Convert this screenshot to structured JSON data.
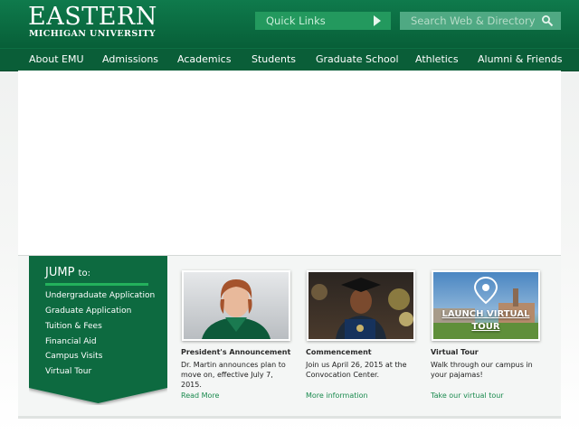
{
  "header": {
    "logo_main": "EASTERN",
    "logo_sub": "MICHIGAN UNIVERSITY",
    "quick_links_label": "Quick Links",
    "search_placeholder": "Search Web & Directory"
  },
  "nav": {
    "items": [
      {
        "label": "About EMU"
      },
      {
        "label": "Admissions"
      },
      {
        "label": "Academics"
      },
      {
        "label": "Students"
      },
      {
        "label": "Graduate School"
      },
      {
        "label": "Athletics"
      },
      {
        "label": "Alumni & Friends"
      }
    ]
  },
  "jump": {
    "title": "JUMP",
    "title_suffix": "to:",
    "links": [
      {
        "label": "Undergraduate Application"
      },
      {
        "label": "Graduate Application"
      },
      {
        "label": "Tuition & Fees"
      },
      {
        "label": "Financial Aid"
      },
      {
        "label": "Campus Visits"
      },
      {
        "label": "Virtual Tour"
      }
    ]
  },
  "cards": [
    {
      "title": "President's Announcement",
      "text": "Dr. Martin announces plan to move on, effective July 7, 2015.",
      "link": "Read More",
      "image": "president-photo"
    },
    {
      "title": "Commencement",
      "text": "Join us April 26, 2015 at the Convocation Center.",
      "link": "More information",
      "image": "graduate-photo"
    },
    {
      "title": "Virtual Tour",
      "text": "Walk through our campus in your pajamas!",
      "link": "Take our virtual tour",
      "image": "campus-photo",
      "overlay_label": "LAUNCH VIRTUAL TOUR"
    }
  ],
  "colors": {
    "brand_green": "#0a6a40",
    "nav_green": "#0a5e38",
    "accent_green": "#23b15c",
    "link_green": "#1a8a4e"
  }
}
